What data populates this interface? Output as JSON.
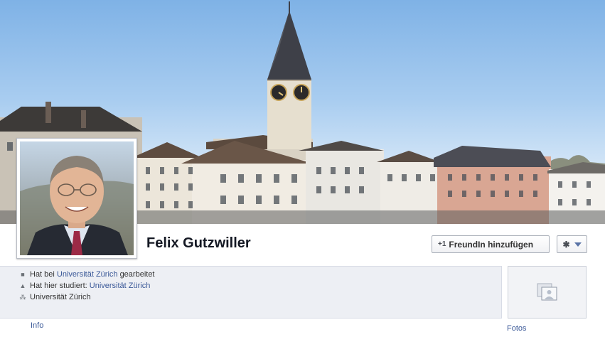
{
  "profile": {
    "name": "Felix Gutzwiller"
  },
  "actions": {
    "add_friend_icon": "+1",
    "add_friend_label": "FreundIn hinzufügen",
    "settings_icon": "gear-icon"
  },
  "info": {
    "work_prefix": "Hat bei",
    "work_link": "Universität Zürich",
    "work_suffix": "gearbeitet",
    "study_prefix": "Hat hier studiert:",
    "study_link": "Universität Zürich",
    "network": "Universität Zürich"
  },
  "tabs": {
    "info_label": "Info",
    "photos_label": "Fotos"
  },
  "colors": {
    "link": "#3b5998",
    "info_bg": "#edeff4",
    "name": "#141823"
  }
}
